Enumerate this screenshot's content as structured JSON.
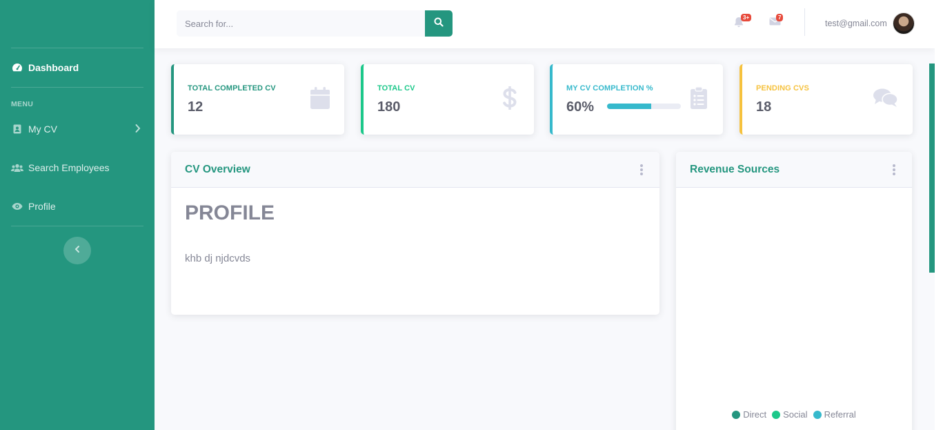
{
  "sidebar": {
    "dashboard_label": "Dashboard",
    "menu_heading": "MENU",
    "items": [
      {
        "label": "My CV"
      },
      {
        "label": "Search Employees"
      },
      {
        "label": "Profile"
      }
    ]
  },
  "topbar": {
    "search_placeholder": "Search for...",
    "alerts_badge": "3+",
    "messages_badge": "7",
    "user_email": "test@gmail.com"
  },
  "stats": [
    {
      "label": "TOTAL COMPLETED CV",
      "value": "12",
      "color": "#24967f",
      "icon": "calendar-icon"
    },
    {
      "label": "TOTAL CV",
      "value": "180",
      "color": "#1cc88a",
      "icon": "dollar-icon"
    },
    {
      "label": "MY CV COMPLETION %",
      "value": "60%",
      "color": "#36b9cc",
      "icon": "clipboard-list-icon",
      "progress_percent": 60
    },
    {
      "label": "PENDING CVS",
      "value": "18",
      "color": "#f6c23e",
      "icon": "comments-icon"
    }
  ],
  "cv_overview": {
    "title": "CV Overview",
    "heading": "PROFILE",
    "text": "khb dj njdcvds"
  },
  "revenue": {
    "title": "Revenue Sources",
    "legend": [
      {
        "label": "Direct",
        "color": "#24967f"
      },
      {
        "label": "Social",
        "color": "#1cc88a"
      },
      {
        "label": "Referral",
        "color": "#36b9cc"
      }
    ]
  },
  "colors": {
    "primary": "#24967f",
    "badge": "#e74a3b"
  }
}
